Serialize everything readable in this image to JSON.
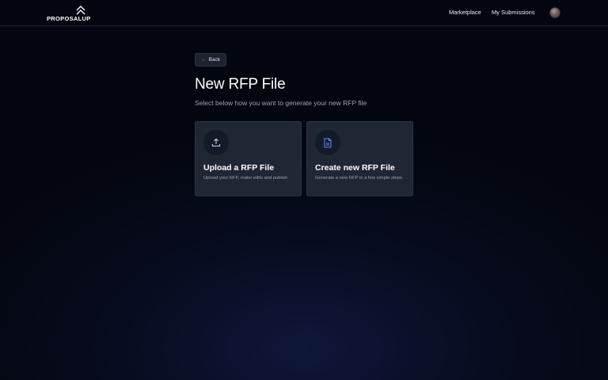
{
  "brand": {
    "name_part1": "PROPOSAL",
    "name_part2": "UP"
  },
  "nav": {
    "marketplace": "Marketplace",
    "my_submissions": "My Submissions"
  },
  "back_button": {
    "label": "Back"
  },
  "page": {
    "title": "New RFP File",
    "subtitle": "Select below how you want to generate your new RFP file"
  },
  "cards": [
    {
      "title": "Upload a RFP File",
      "description": "Upload your RFP, make edits and publish",
      "icon": "upload-icon"
    },
    {
      "title": "Create new RFP File",
      "description": "Generate a new RFP in a few simple steps.",
      "icon": "document-icon"
    }
  ],
  "colors": {
    "background": "#03060f",
    "card": "#1f2634",
    "accent_icon": "#6f8cff"
  }
}
